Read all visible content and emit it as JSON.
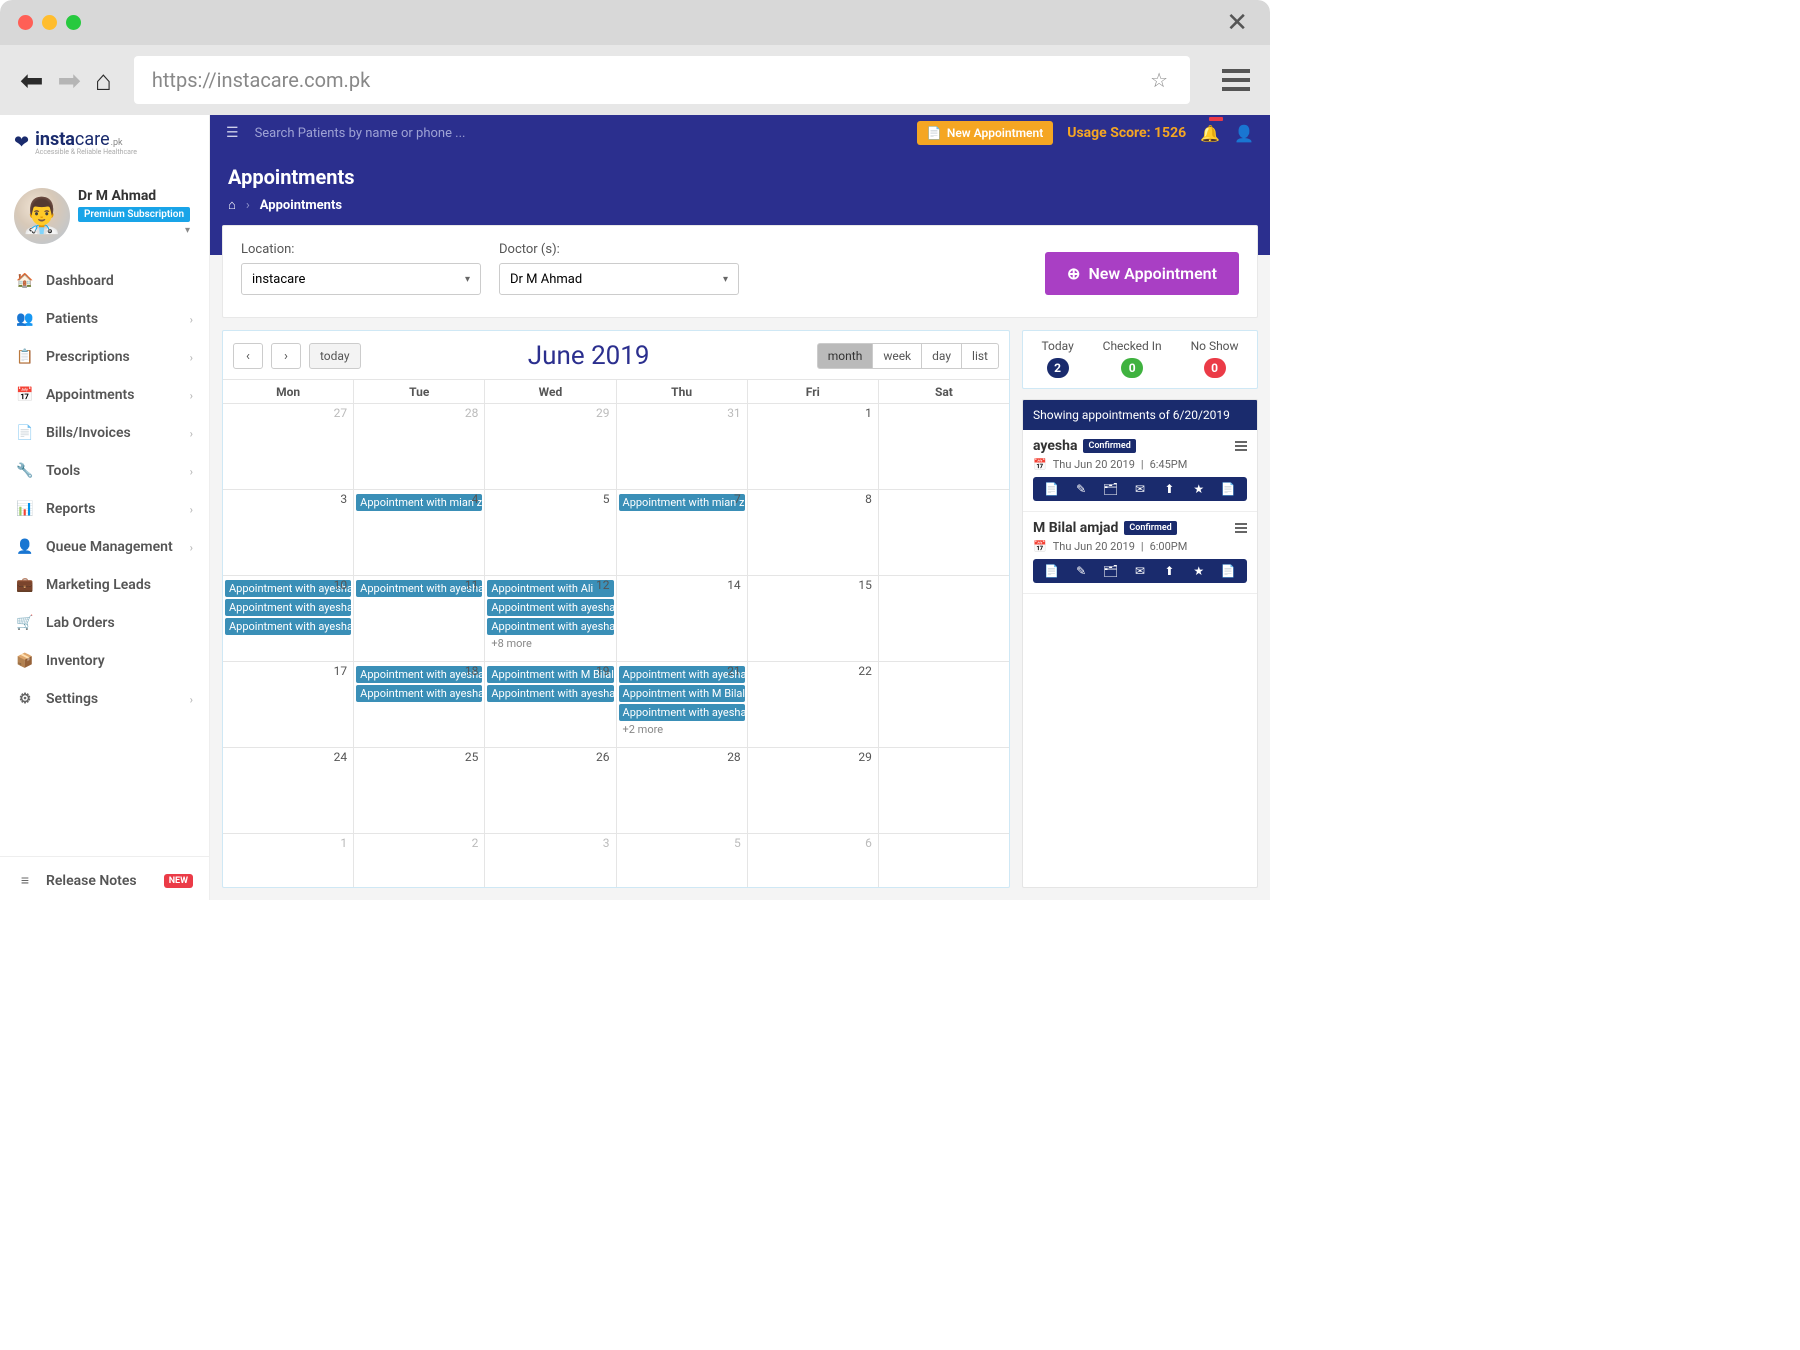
{
  "browser": {
    "url": "https://instacare.com.pk"
  },
  "brand": {
    "name_bold": "insta",
    "name_light": "care",
    "suffix": ".pk",
    "tagline": "Accessible & Reliable Healthcare"
  },
  "profile": {
    "name": "Dr M Ahmad",
    "badge": "Premium Subscription"
  },
  "sidebar": {
    "items": [
      {
        "icon": "🏠",
        "label": "Dashboard",
        "chev": false
      },
      {
        "icon": "👥",
        "label": "Patients",
        "chev": true
      },
      {
        "icon": "📋",
        "label": "Prescriptions",
        "chev": true
      },
      {
        "icon": "📅",
        "label": "Appointments",
        "chev": true
      },
      {
        "icon": "📄",
        "label": "Bills/Invoices",
        "chev": true
      },
      {
        "icon": "🔧",
        "label": "Tools",
        "chev": true
      },
      {
        "icon": "📊",
        "label": "Reports",
        "chev": true
      },
      {
        "icon": "👤",
        "label": "Queue Management",
        "chev": true
      },
      {
        "icon": "💼",
        "label": "Marketing Leads",
        "chev": false
      },
      {
        "icon": "🛒",
        "label": "Lab Orders",
        "chev": false
      },
      {
        "icon": "📦",
        "label": "Inventory",
        "chev": false
      },
      {
        "icon": "⚙",
        "label": "Settings",
        "chev": true
      }
    ],
    "release": {
      "icon": "≡",
      "label": "Release Notes",
      "badge": "NEW"
    }
  },
  "topbar": {
    "search_placeholder": "Search Patients by name or phone ...",
    "new_appt": "New Appointment",
    "usage_label": "Usage Score: 1526"
  },
  "page": {
    "title": "Appointments",
    "breadcrumb_current": "Appointments"
  },
  "filters": {
    "location_label": "Location:",
    "location_value": "instacare",
    "doctor_label": "Doctor (s):",
    "doctor_value": "Dr M Ahmad",
    "new_btn": "New Appointment"
  },
  "calendar": {
    "today_btn": "today",
    "title": "June 2019",
    "views": [
      "month",
      "week",
      "day",
      "list"
    ],
    "active_view": "month",
    "day_headers": [
      "Mon",
      "Tue",
      "Wed",
      "Thu",
      "Fri",
      "Sat"
    ],
    "weeks": [
      {
        "cells": [
          {
            "num": "27",
            "current": false,
            "events": []
          },
          {
            "num": "28",
            "current": false,
            "events": []
          },
          {
            "num": "29",
            "current": false,
            "events": []
          },
          {
            "num": "31",
            "current": false,
            "events": []
          },
          {
            "num": "1",
            "current": true,
            "events": []
          },
          {
            "num": "",
            "current": false,
            "events": []
          }
        ]
      },
      {
        "cells": [
          {
            "num": "3",
            "current": true,
            "events": []
          },
          {
            "num": "4",
            "current": true,
            "events": [
              "Appointment with mian zubair"
            ]
          },
          {
            "num": "5",
            "current": true,
            "events": []
          },
          {
            "num": "7",
            "current": true,
            "events": [
              "Appointment with mian zubair"
            ]
          },
          {
            "num": "8",
            "current": true,
            "events": []
          },
          {
            "num": "",
            "current": false,
            "events": []
          }
        ]
      },
      {
        "cells": [
          {
            "num": "10",
            "current": true,
            "events": [
              "Appointment with ayesha",
              "Appointment with ayesha",
              "Appointment with ayesha"
            ]
          },
          {
            "num": "11",
            "current": true,
            "events": [
              "Appointment with ayesha"
            ]
          },
          {
            "num": "12",
            "current": true,
            "events": [
              "Appointment with Ali",
              "Appointment with ayesha",
              "Appointment with ayesha"
            ],
            "more": "+8 more"
          },
          {
            "num": "14",
            "current": true,
            "events": []
          },
          {
            "num": "15",
            "current": true,
            "events": []
          },
          {
            "num": "",
            "current": false,
            "events": []
          }
        ]
      },
      {
        "cells": [
          {
            "num": "17",
            "current": true,
            "events": []
          },
          {
            "num": "18",
            "current": true,
            "events": [
              "Appointment with ayesha",
              "Appointment with ayesha"
            ]
          },
          {
            "num": "19",
            "current": true,
            "events": [
              "Appointment with M Bilal amjad",
              "Appointment with ayesha"
            ]
          },
          {
            "num": "21",
            "current": true,
            "events": [
              "Appointment with ayesha",
              "Appointment with M Bilal amjad",
              "Appointment with ayesha"
            ],
            "more": "+2 more"
          },
          {
            "num": "22",
            "current": true,
            "events": []
          },
          {
            "num": "",
            "current": false,
            "events": []
          }
        ]
      },
      {
        "cells": [
          {
            "num": "24",
            "current": true,
            "events": []
          },
          {
            "num": "25",
            "current": true,
            "events": []
          },
          {
            "num": "26",
            "current": true,
            "events": []
          },
          {
            "num": "28",
            "current": true,
            "events": []
          },
          {
            "num": "29",
            "current": true,
            "events": []
          },
          {
            "num": "",
            "current": false,
            "events": []
          }
        ]
      },
      {
        "cells": [
          {
            "num": "1",
            "current": false,
            "events": []
          },
          {
            "num": "2",
            "current": false,
            "events": []
          },
          {
            "num": "3",
            "current": false,
            "events": []
          },
          {
            "num": "5",
            "current": false,
            "events": []
          },
          {
            "num": "6",
            "current": false,
            "events": []
          },
          {
            "num": "",
            "current": false,
            "events": []
          }
        ]
      }
    ]
  },
  "stats": {
    "today": {
      "label": "Today",
      "value": "2"
    },
    "checked": {
      "label": "Checked In",
      "value": "0"
    },
    "noshow": {
      "label": "No Show",
      "value": "0"
    }
  },
  "appointments_panel": {
    "header": "Showing appointments of 6/20/2019",
    "items": [
      {
        "name": "ayesha",
        "status": "Confirmed",
        "date": "Thu Jun 20 2019",
        "time": "6:45PM"
      },
      {
        "name": "M Bilal amjad",
        "status": "Confirmed",
        "date": "Thu Jun 20 2019",
        "time": "6:00PM"
      }
    ]
  }
}
